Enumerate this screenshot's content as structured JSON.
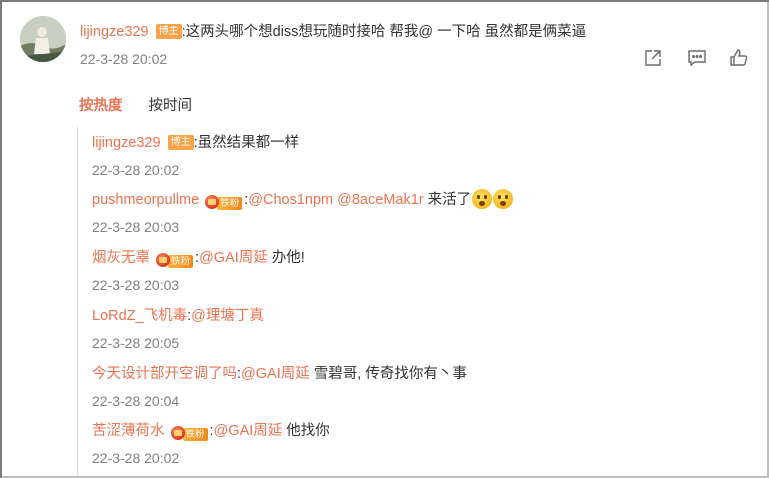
{
  "post": {
    "username": "lijingze329",
    "badge": "博主",
    "text": ":这两头哪个想diss想玩随时接哈 帮我@ 一下哈 虽然都是俩菜逼",
    "time": "22-3-28 20:02",
    "actions": [
      "share-icon",
      "comment-icon",
      "like-icon"
    ]
  },
  "tabs": {
    "hot": "按热度",
    "time": "按时间"
  },
  "replies": [
    {
      "username": "lijingze329",
      "badge": "博主",
      "fan_label": "",
      "text": ":虽然结果都一样",
      "mention": "",
      "after": "",
      "time": "22-3-28 20:02"
    },
    {
      "username": "pushmeorpullme",
      "badge": "",
      "fan_label": "铁粉",
      "text": ":",
      "mention": "@Chos1npm @8aceMak1r",
      "after": " 来活了",
      "time": "22-3-28 20:03"
    },
    {
      "username": "烟灰无辜",
      "badge": "",
      "fan_label": "铁粉",
      "text": ":",
      "mention": "@GAI周延",
      "after": " 办他!",
      "time": "22-3-28 20:03"
    },
    {
      "username": "LoRdZ_飞机毒",
      "badge": "",
      "fan_label": "",
      "text": ":",
      "mention": "@理塘丁真",
      "after": "",
      "time": "22-3-28 20:05"
    },
    {
      "username": "今天设计部开空调了吗",
      "badge": "",
      "fan_label": "",
      "text": ":",
      "mention": "@GAI周延",
      "after": " 雪碧哥, 传奇找你有丶事",
      "time": "22-3-28 20:04"
    },
    {
      "username": "苦涩薄荷水",
      "badge": "",
      "fan_label": "铁粉",
      "text": ":",
      "mention": "@GAI周延",
      "after": " 他找你",
      "time": "22-3-28 20:02"
    }
  ]
}
